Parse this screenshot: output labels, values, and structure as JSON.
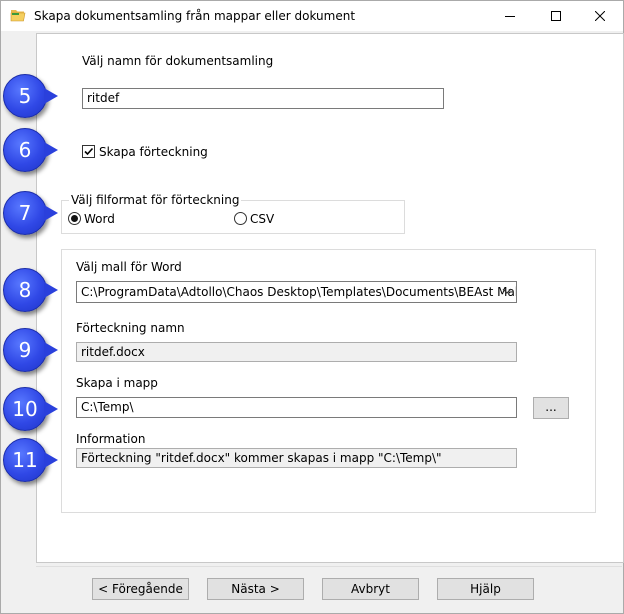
{
  "window": {
    "title": "Skapa dokumentsamling från mappar eller dokument"
  },
  "collection_name": {
    "label": "Välj namn för dokumentsamling",
    "value": "ritdef"
  },
  "create_index": {
    "label": "Skapa förteckning",
    "checked": true
  },
  "file_format": {
    "legend": "Välj filformat för förteckning",
    "options": [
      {
        "label": "Word",
        "selected": true
      },
      {
        "label": "CSV",
        "selected": false
      }
    ]
  },
  "template": {
    "label": "Välj mall för Word",
    "value": "C:\\ProgramData\\Adtollo\\Chaos Desktop\\Templates\\Documents\\BEAst Mall Hä"
  },
  "index_name": {
    "label": "Förteckning namn",
    "value": "ritdef.docx"
  },
  "folder": {
    "label": "Skapa i mapp",
    "value": "C:\\Temp\\",
    "browse_label": "..."
  },
  "information": {
    "label": "Information",
    "value": "Förteckning \"ritdef.docx\" kommer skapas i mapp \"C:\\Temp\\\""
  },
  "buttons": {
    "back": "< Föregående",
    "next": "Nästa >",
    "cancel": "Avbryt",
    "help": "Hjälp"
  },
  "callouts": [
    "5",
    "6",
    "7",
    "8",
    "9",
    "10",
    "11"
  ],
  "colors": {
    "callout": "#3048e6",
    "dialog_bg": "#f0f0f0"
  }
}
